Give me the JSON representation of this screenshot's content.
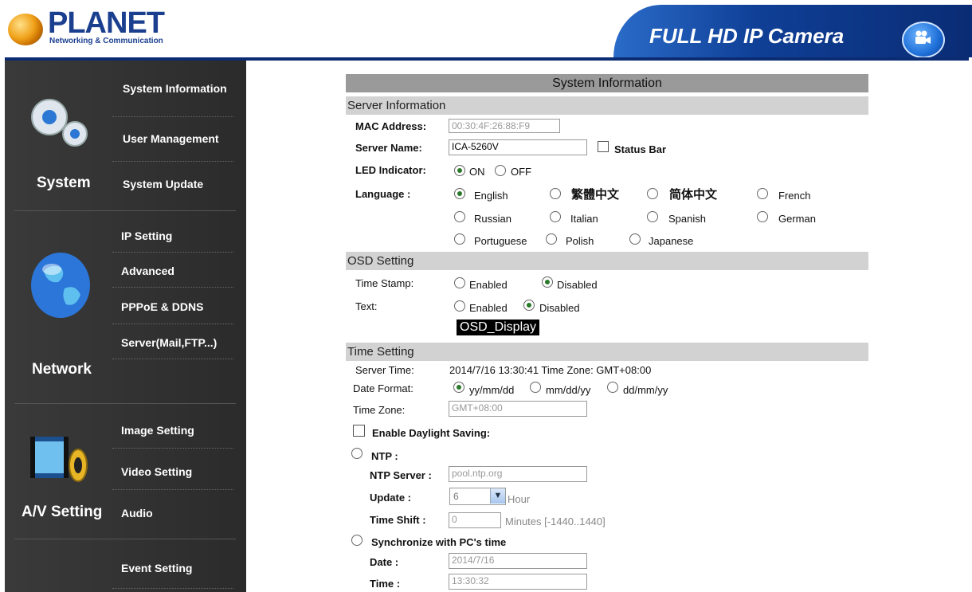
{
  "header": {
    "logo": "PLANET",
    "logo_sub": "Networking & Communication",
    "banner_title": "FULL HD IP Camera"
  },
  "sidebar": {
    "system": {
      "label": "System",
      "items": [
        "System Information",
        "User Management",
        "System Update"
      ]
    },
    "network": {
      "label": "Network",
      "items": [
        "IP Setting",
        "Advanced",
        "PPPoE & DDNS",
        "Server(Mail,FTP...)"
      ]
    },
    "av": {
      "label": "A/V Setting",
      "items": [
        "Image Setting",
        "Video Setting",
        "Audio"
      ]
    },
    "event": {
      "items": [
        "Event Setting"
      ]
    }
  },
  "main": {
    "title": "System Information",
    "server_info": {
      "heading": "Server Information",
      "mac_label": "MAC Address:",
      "mac_value": "00:30:4F:26:88:F9",
      "name_label": "Server Name:",
      "name_value": "ICA-5260V",
      "status_bar": "Status Bar",
      "led_label": "LED Indicator:",
      "led_on": "ON",
      "led_off": "OFF",
      "language_label": "Language :",
      "languages": [
        "English",
        "繁體中文",
        "简体中文",
        "French",
        "Russian",
        "Italian",
        "Spanish",
        "German",
        "Portuguese",
        "Polish",
        "Japanese"
      ]
    },
    "osd": {
      "heading": "OSD Setting",
      "timestamp_label": "Time Stamp:",
      "text_label": "Text:",
      "enabled": "Enabled",
      "disabled": "Disabled",
      "osd_display": "OSD_Display"
    },
    "time": {
      "heading": "Time Setting",
      "server_time_label": "Server Time:",
      "server_time_value": "2014/7/16 13:30:41 Time Zone: GMT+08:00",
      "date_format_label": "Date Format:",
      "formats": [
        "yy/mm/dd",
        "mm/dd/yy",
        "dd/mm/yy"
      ],
      "timezone_label": "Time Zone:",
      "timezone_value": "GMT+08:00",
      "daylight": "Enable Daylight Saving:",
      "ntp": "NTP :",
      "ntp_server_label": "NTP Server :",
      "ntp_server_value": "pool.ntp.org",
      "update_label": "Update :",
      "update_value": "6",
      "update_unit": "Hour",
      "shift_label": "Time Shift :",
      "shift_value": "0",
      "shift_unit": "Minutes  [-1440..1440]",
      "sync": "Synchronize with PC's time",
      "date_label": "Date :",
      "date_value": "2014/7/16",
      "time_label": "Time :",
      "time_value": "13:30:32"
    }
  },
  "colors": {
    "sidebar_bg": "#2f2f2f",
    "banner": "#0f3f96",
    "section_bg": "#d2d2d2",
    "title_bg": "#9a9a9a"
  }
}
